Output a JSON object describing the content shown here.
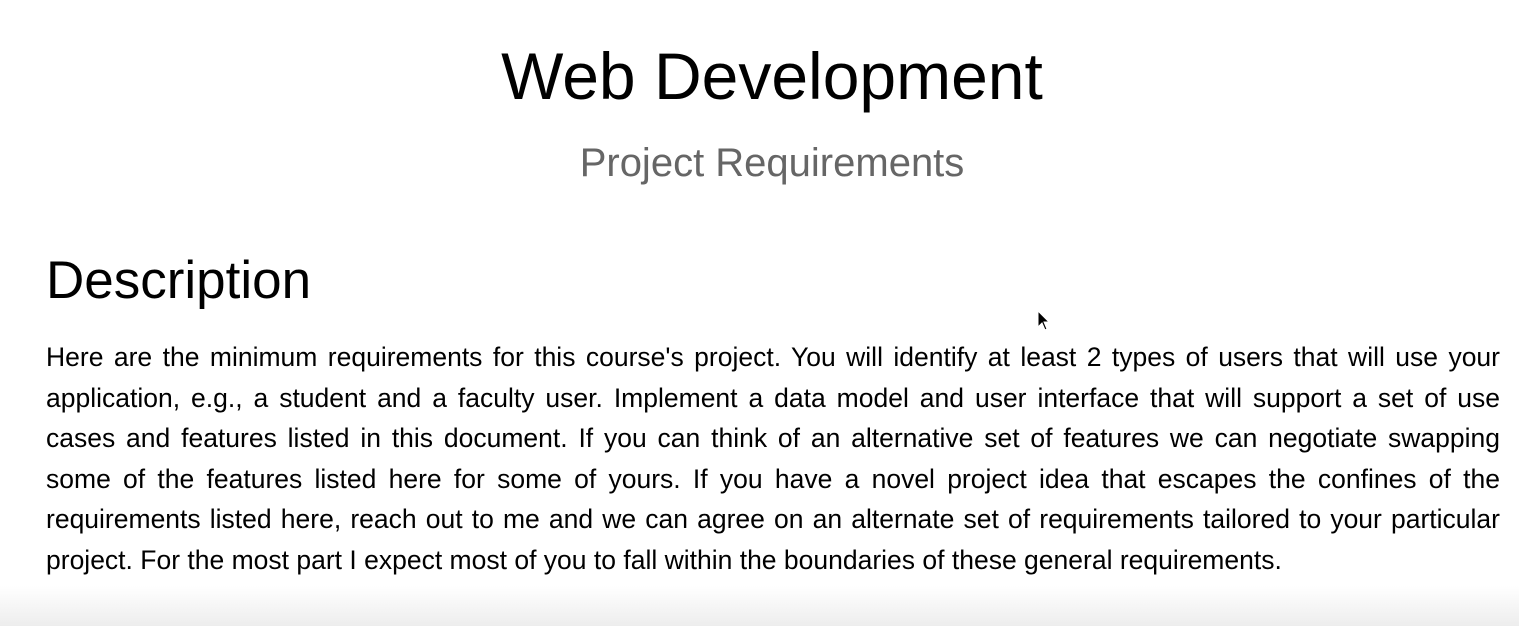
{
  "document": {
    "title": "Web Development",
    "subtitle": "Project Requirements",
    "sections": [
      {
        "heading": "Description",
        "body": "Here are the minimum requirements for this course's project. You will identify at least 2 types of users that will use your application, e.g., a student and a faculty user. Implement a data model and user interface that will support a set of use cases and features listed in this document. If you can think of an alternative set of features we can negotiate swapping some of the features listed here for some of yours. If you have a novel project idea that escapes the confines of the requirements listed here, reach out to me and we can agree on an alternate set of requirements tailored to your particular project. For the most part I expect most of you to fall within the boundaries of these general requirements."
      }
    ]
  },
  "cursor": {
    "icon": "mouse-pointer-icon"
  }
}
